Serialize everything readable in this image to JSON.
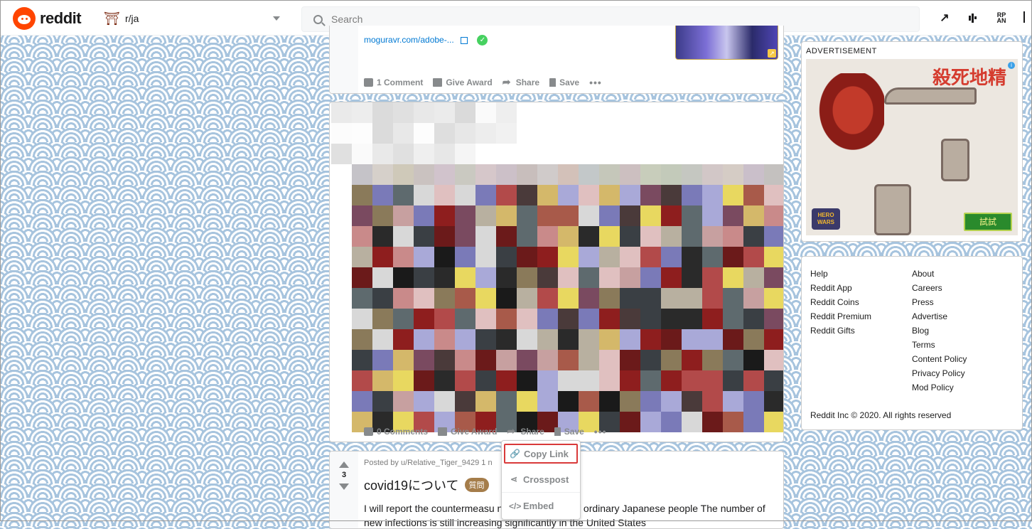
{
  "header": {
    "logo_text": "reddit",
    "community": "r/ja",
    "search_placeholder": "Search",
    "rpan_label_top": "RP",
    "rpan_label_bottom": "AN"
  },
  "post1": {
    "source": "moguravr.com/adobe-...",
    "comments": "1 Comment",
    "give_award": "Give Award",
    "share": "Share",
    "save": "Save"
  },
  "post2": {
    "comments": "0 Comments",
    "give_award": "Give Award",
    "share": "Share",
    "save": "Save"
  },
  "share_menu": {
    "copy_link": "Copy Link",
    "crosspost": "Crosspost",
    "embed": "Embed"
  },
  "post3": {
    "score": "3",
    "posted_by": "Posted by u/Relative_Tiger_9429 1 n",
    "title": "covid19について",
    "flair": "質問",
    "body": "I will report the countermeasu          new coronavirus of ordinary Japanese people The number of new infections is still increasing significantly in the United States"
  },
  "sidebar": {
    "ad_label": "ADVERTISEMENT",
    "ad_headline": "殺死地精",
    "ad_cta": "試試",
    "ad_logo": "HERO WARS",
    "links_left": [
      "Help",
      "Reddit App",
      "Reddit Coins",
      "Reddit Premium",
      "Reddit Gifts"
    ],
    "links_right": [
      "About",
      "Careers",
      "Press",
      "Advertise",
      "Blog",
      "Terms",
      "Content Policy",
      "Privacy Policy",
      "Mod Policy"
    ],
    "copyright": "Reddit Inc © 2020. All rights reserved"
  },
  "colors": {
    "accent": "#ff4500",
    "link": "#0079d3",
    "action_gray": "#878a8c",
    "highlight": "#d93a3a"
  }
}
